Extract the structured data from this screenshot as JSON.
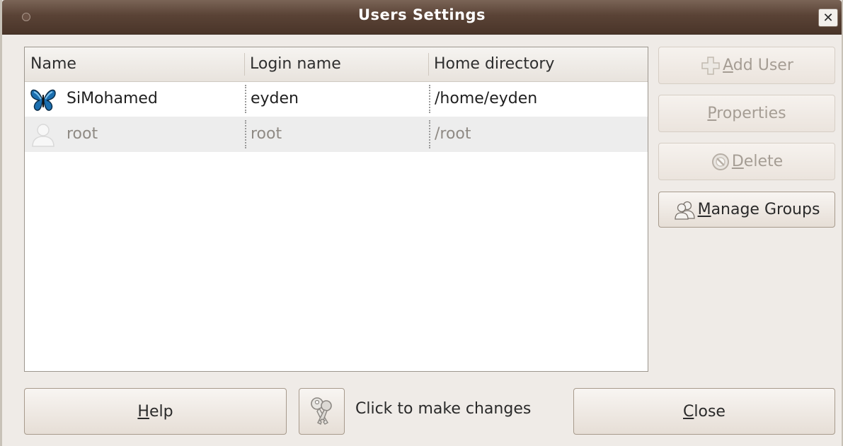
{
  "window": {
    "title": "Users Settings",
    "close_glyph": "✕"
  },
  "table": {
    "columns": [
      "Name",
      "Login name",
      "Home directory"
    ],
    "rows": [
      {
        "name": "SiMohamed",
        "login": "eyden",
        "home": "/home/eyden",
        "avatar": "butterfly-icon",
        "muted": false
      },
      {
        "name": "root",
        "login": "root",
        "home": "/root",
        "avatar": "user-silhouette-icon",
        "muted": true
      }
    ]
  },
  "side_buttons": {
    "add_user": {
      "pre": "",
      "key": "A",
      "post": "dd User",
      "enabled": false,
      "icon": "plus-icon"
    },
    "properties": {
      "pre": "",
      "key": "P",
      "post": "roperties",
      "enabled": false
    },
    "delete": {
      "pre": "",
      "key": "D",
      "post": "elete",
      "enabled": false,
      "icon": "no-entry-icon"
    },
    "manage_groups": {
      "pre": "",
      "key": "M",
      "post": "anage Groups",
      "enabled": true,
      "icon": "group-icon"
    }
  },
  "bottom": {
    "help": {
      "pre": "",
      "key": "H",
      "post": "elp"
    },
    "unlock_text": "Click to make changes",
    "unlock_icon": "keys-icon",
    "close": {
      "pre": "",
      "key": "C",
      "post": "lose"
    }
  },
  "colors": {
    "titlebar": "#5a4336",
    "window_bg": "#efebe7",
    "alt_row": "#ededed"
  }
}
